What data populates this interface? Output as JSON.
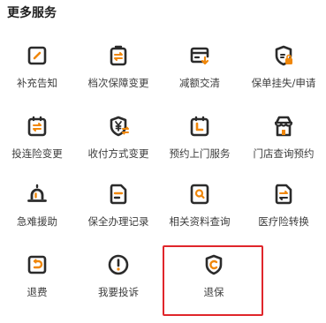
{
  "section_title": "更多服务",
  "colors": {
    "accent": "#f0870a",
    "icon_dark": "#2b2b2b",
    "highlight": "#e0262b"
  },
  "services": [
    {
      "label": "补充告知",
      "icon": "pencil-icon"
    },
    {
      "label": "档次保障变更",
      "icon": "swap-document-icon"
    },
    {
      "label": "减额交清",
      "icon": "card-reduce-icon"
    },
    {
      "label": "保单挂失/申请",
      "icon": "shield-lock-icon"
    },
    {
      "label": "投连险变更",
      "icon": "clipboard-swap-icon"
    },
    {
      "label": "收付方式变更",
      "icon": "yen-shield-icon"
    },
    {
      "label": "预约上门服务",
      "icon": "calendar-icon"
    },
    {
      "label": "门店查询预约",
      "icon": "store-icon"
    },
    {
      "label": "急难援助",
      "icon": "alarm-icon"
    },
    {
      "label": "保全办理记录",
      "icon": "record-document-icon"
    },
    {
      "label": "相关资料查询",
      "icon": "search-document-icon"
    },
    {
      "label": "医疗险转换",
      "icon": "medical-swap-icon"
    },
    {
      "label": "退费",
      "icon": "refund-icon"
    },
    {
      "label": "我要投诉",
      "icon": "complaint-icon"
    },
    {
      "label": "退保",
      "icon": "surrender-shield-icon"
    }
  ]
}
